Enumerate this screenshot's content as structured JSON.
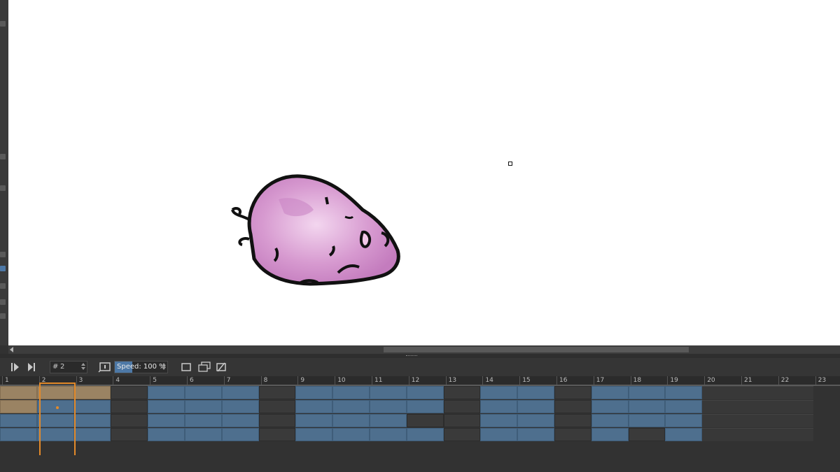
{
  "toolbar": {
    "frame_hash": "#",
    "frame_value": "2",
    "speed_label": "Speed: 100 %",
    "speed_fill": 0.33
  },
  "ruler": {
    "frames": [
      "1",
      "2",
      "3",
      "4",
      "5",
      "6",
      "7",
      "8",
      "9",
      "10",
      "11",
      "12",
      "13",
      "14",
      "15",
      "16",
      "17",
      "18",
      "19",
      "20",
      "21",
      "22",
      "23"
    ]
  },
  "timeline": {
    "current_frame": 2,
    "rows": [
      "BBBEKKKEKKKKEKKEKKKRRR",
      "BKKEKKKEKKKKEKKEKKKRRR",
      "KKKEKKKEKKKEEKKEKKKRRR",
      "KKKEKKKEKKKKEKKEKEKRRR"
    ]
  },
  "colors": {
    "accent": "#e38a2a",
    "keyframe": "#4e6f8e",
    "selected_layer": "#9a8363",
    "canvas": "#ffffff"
  }
}
